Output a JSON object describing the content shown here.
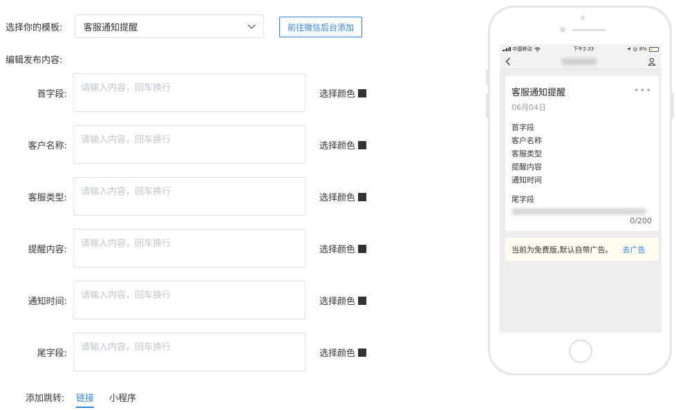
{
  "template": {
    "label": "选择你的模板:",
    "selected": "客服通知提醒",
    "wechat_button": "前往微信后台添加"
  },
  "section_title": "编辑发布内容:",
  "placeholder": "请输入内容，回车换行",
  "color_label": "选择颜色",
  "colors": {
    "swatch": "#333333",
    "accent": "#2d83e0"
  },
  "fields": [
    {
      "label": "首字段:"
    },
    {
      "label": "客户名称:"
    },
    {
      "label": "客服类型:"
    },
    {
      "label": "提醒内容:"
    },
    {
      "label": "通知时间:"
    },
    {
      "label": "尾字段:"
    }
  ],
  "jump": {
    "label": "添加跳转:",
    "tabs": [
      "链接",
      "小程序"
    ],
    "active": "链接"
  },
  "phone": {
    "status": {
      "carrier": "中国移动",
      "time": "下午2:33",
      "battery": "8%"
    },
    "message": {
      "title": "客服通知提醒",
      "date": "06月04日",
      "fields": [
        "首字段",
        "客户名称",
        "客服类型",
        "提醒内容",
        "通知时间"
      ],
      "tail": "尾字段",
      "count": "0/200"
    },
    "ad": {
      "text": "当前为免费版,默认自带广告。",
      "link": "去广告"
    }
  }
}
